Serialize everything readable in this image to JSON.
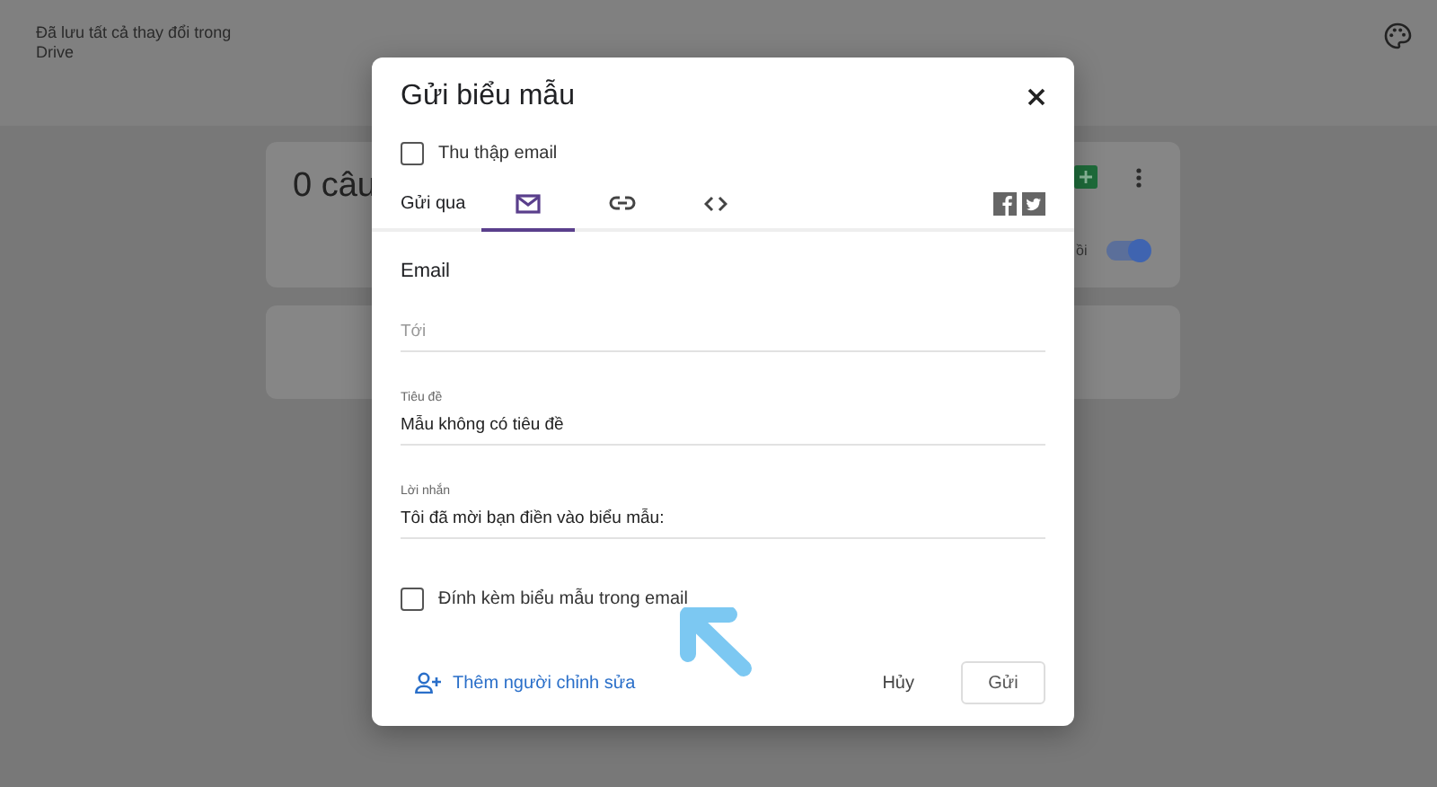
{
  "header": {
    "save_status": "Đã lưu tất cả thay đổi trong Drive"
  },
  "form_card": {
    "title": "0 câu",
    "toggle_label": "ồi",
    "toggle_on": true
  },
  "dialog": {
    "title": "Gửi biểu mẫu",
    "collect_email": {
      "label": "Thu thập email",
      "checked": false
    },
    "send_via_label": "Gửi qua",
    "tabs": [
      {
        "kind": "mail",
        "selected": true
      },
      {
        "kind": "link",
        "selected": false
      },
      {
        "kind": "embed",
        "selected": false
      }
    ],
    "section_title": "Email",
    "fields": [
      {
        "placeholder": "Tới"
      },
      {
        "label": "Tiêu đề",
        "value": "Mẫu không có tiêu đề"
      },
      {
        "label": "Lời nhắn",
        "value": "Tôi đã mời bạn điền vào biểu mẫu:"
      }
    ],
    "attach_form": {
      "label": "Đính kèm biểu mẫu trong email",
      "checked": false
    },
    "add_editors": "Thêm người chỉnh sửa",
    "buttons": [
      {
        "kind": "cancel",
        "label": "Hủy"
      },
      {
        "kind": "send",
        "label": "Gửi"
      }
    ]
  }
}
